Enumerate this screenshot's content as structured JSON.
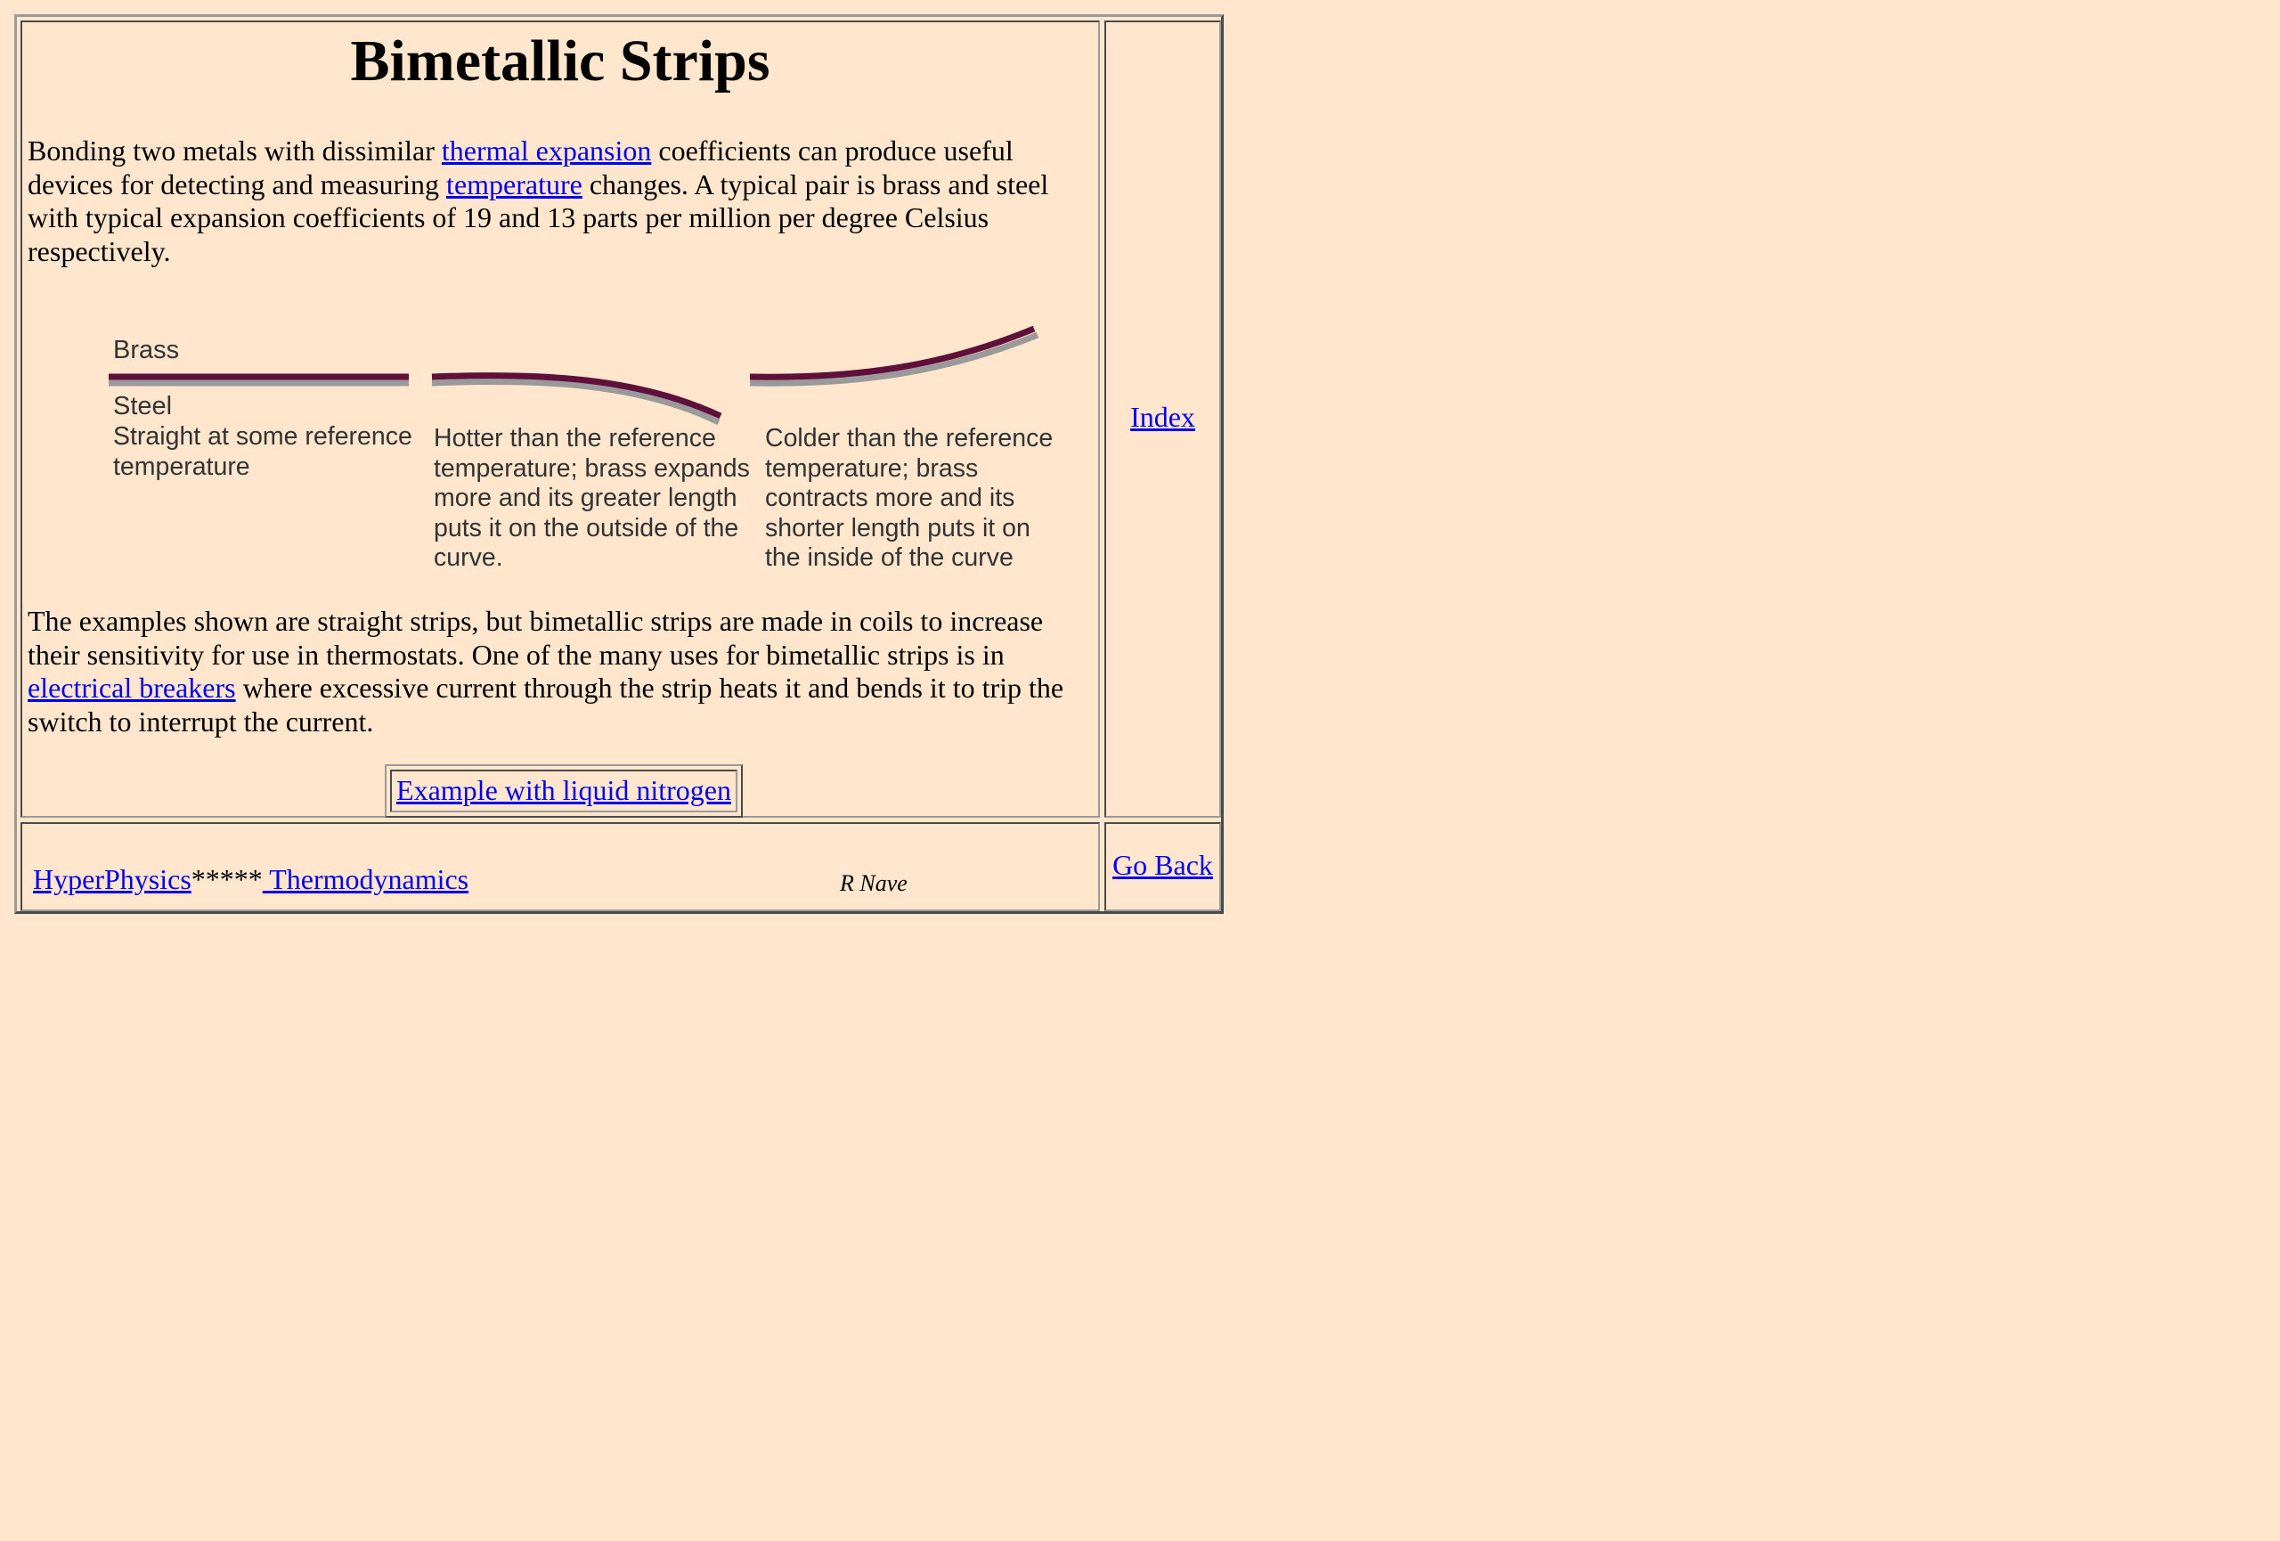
{
  "page": {
    "title": "Bimetallic Strips"
  },
  "intro": {
    "text_1": "Bonding two metals with dissimilar ",
    "link_thermal": "thermal expansion",
    "text_2": " coefficients can produce useful devices for detecting and measuring ",
    "link_temperature": "temperature",
    "text_3": " changes. A typical pair is brass and steel with typical expansion coefficients of 19 and 13 parts per million per degree Celsius respectively."
  },
  "figure": {
    "label_brass": "Brass",
    "label_steel": "Steel",
    "caption_straight": "Straight at some reference temperature",
    "caption_hotter": "Hotter than the reference temperature; brass expands more and its greater length puts it on the outside of the curve.",
    "caption_colder": "Colder than the reference temperature; brass contracts more and its shorter length puts it on the inside of the curve",
    "colors": {
      "brass": "#5e0f3a",
      "steel": "#9a9a9a"
    }
  },
  "examples": {
    "text_1": "The examples shown are straight strips, but bimetallic strips are made in coils to increase their sensitivity for use in thermostats. One of the many uses for bimetallic strips is in ",
    "link_breakers": "electrical breakers",
    "text_2": " where excessive current through the strip heats it and bends it to trip the switch to interrupt the current."
  },
  "example_button": {
    "label": "Example with liquid nitrogen"
  },
  "sidebar": {
    "index_label": "Index"
  },
  "footer": {
    "hyperphysics_label": "HyperPhysics",
    "separator": "*****",
    "thermodynamics_label": " Thermodynamics",
    "author": "R Nave",
    "go_back_label": "Go Back"
  }
}
